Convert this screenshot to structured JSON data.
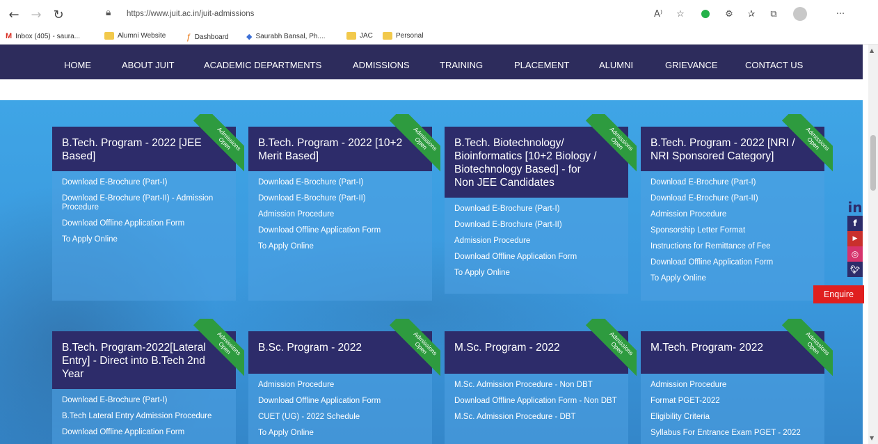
{
  "browser": {
    "url": "https://www.juit.ac.in/juit-admissions",
    "toolbar_icons": [
      "read-aloud-icon",
      "favorites-icon",
      "extension-icon",
      "extensions-icon",
      "favorites-bar-icon",
      "collections-icon",
      "profile-icon",
      "more-icon"
    ],
    "more_label": "···"
  },
  "bookmarks": [
    {
      "label": "Inbox (405) - saura...",
      "icon": "gmail-icon"
    },
    {
      "label": "Alumni Website",
      "icon": "folder-icon"
    },
    {
      "label": "Dashboard",
      "icon": "dashboard-icon"
    },
    {
      "label": "Saurabh Bansal, Ph....",
      "icon": "diamond-icon"
    },
    {
      "label": "JAC",
      "icon": "folder-icon"
    },
    {
      "label": "Personal",
      "icon": "folder-icon"
    }
  ],
  "nav": [
    "HOME",
    "ABOUT JUIT",
    "ACADEMIC DEPARTMENTS",
    "ADMISSIONS",
    "TRAINING",
    "PLACEMENT",
    "ALUMNI",
    "GRIEVANCE",
    "CONTACT US"
  ],
  "ribbon": {
    "line1": "Admissions",
    "line2": "Open"
  },
  "cards": [
    {
      "title": "B.Tech. Program - 2022 [JEE Based]",
      "links": [
        "Download E-Brochure (Part-I)",
        "Download E-Brochure (Part-II) - Admission Procedure",
        "Download Offline Application Form",
        "To Apply Online"
      ]
    },
    {
      "title": "B.Tech. Program - 2022 [10+2 Merit Based]",
      "links": [
        "Download E-Brochure (Part-I)",
        "Download E-Brochure (Part-II)",
        "Admission Procedure",
        "Download Offline Application Form",
        "To Apply Online"
      ]
    },
    {
      "title": "B.Tech. Biotechnology/ Bioinformatics [10+2 Biology / Biotechnology Based] - for Non JEE Candidates",
      "links": [
        "Download E-Brochure (Part-I)",
        "Download E-Brochure (Part-II)",
        "Admission Procedure",
        "Download Offline Application Form",
        "To Apply Online"
      ]
    },
    {
      "title": "B.Tech. Program - 2022 [NRI / NRI Sponsored Category]",
      "links": [
        "Download E-Brochure (Part-I)",
        "Download E-Brochure (Part-II)",
        "Admission Procedure",
        "Sponsorship Letter Format",
        "Instructions for Remittance of Fee",
        "Download Offline Application Form",
        "To Apply Online"
      ]
    },
    {
      "title": "B.Tech. Program-2022[Lateral Entry] - Direct into B.Tech 2nd Year",
      "links": [
        "Download E-Brochure (Part-I)",
        "B.Tech Lateral Entry Admission Procedure",
        "Download Offline Application Form"
      ]
    },
    {
      "title": "B.Sc. Program - 2022",
      "links": [
        "Admission Procedure",
        "Download Offline Application Form",
        "CUET (UG) - 2022 Schedule",
        "To Apply Online"
      ]
    },
    {
      "title": "M.Sc. Program - 2022",
      "links": [
        "M.Sc. Admission Procedure - Non DBT",
        "Download Offline Application Form - Non DBT",
        "M.Sc. Admission Procedure - DBT"
      ]
    },
    {
      "title": "M.Tech. Program- 2022",
      "links": [
        "Admission Procedure",
        "Format PGET-2022",
        "Eligibility Criteria",
        "Syllabus For Entrance Exam PGET - 2022"
      ]
    }
  ],
  "social": [
    "linkedin-icon",
    "facebook-icon",
    "youtube-icon",
    "instagram-icon",
    "twitter-icon"
  ],
  "enquire_label": "Enquire"
}
